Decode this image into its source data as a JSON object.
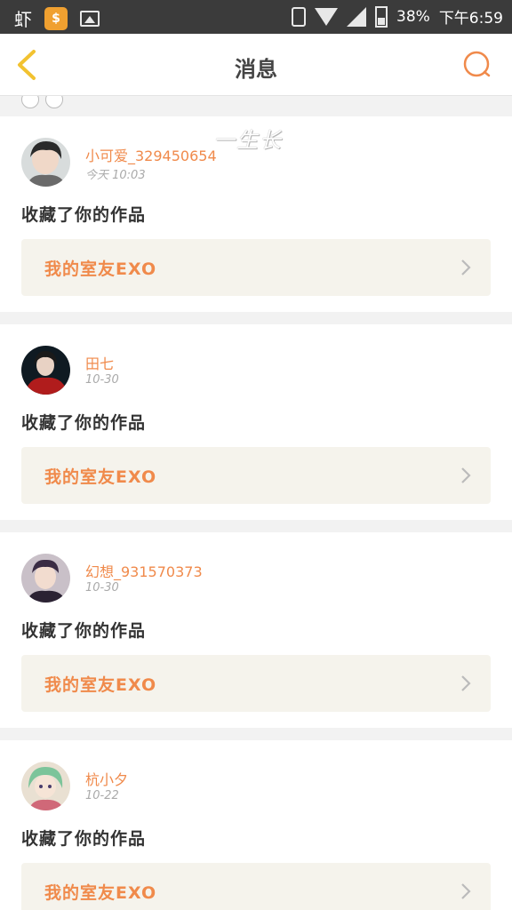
{
  "status_bar": {
    "left_text": "虾",
    "time": "下午6:59",
    "battery": "38%"
  },
  "header": {
    "title": "消息"
  },
  "watermark": "一生长",
  "messages": [
    {
      "user": "小可爱_329450654",
      "time": "今天 10:03",
      "action": "收藏了你的作品",
      "work": "我的室友EXO"
    },
    {
      "user": "田七",
      "time": "10-30",
      "action": "收藏了你的作品",
      "work": "我的室友EXO"
    },
    {
      "user": "幻想_931570373",
      "time": "10-30",
      "action": "收藏了你的作品",
      "work": "我的室友EXO"
    },
    {
      "user": "杭小夕",
      "time": "10-22",
      "action": "收藏了你的作品",
      "work": "我的室友EXO"
    }
  ],
  "colors": {
    "accent": "#f08a4b",
    "back_icon": "#f2c230",
    "card_link_bg": "#f5f3ec"
  }
}
